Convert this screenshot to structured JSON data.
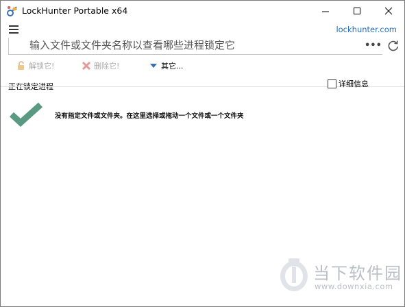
{
  "window": {
    "title": "LockHunter Portable x64",
    "icon": "lockhunter-app-icon"
  },
  "controls": {
    "minimize": "minimize-icon",
    "maximize": "maximize-icon",
    "close": "close-icon"
  },
  "header": {
    "menu_icon": "hamburger-menu-icon",
    "site_link": "lockhunter.com"
  },
  "path_input": {
    "placeholder": "输入文件或文件夹名称以查看哪些进程锁定它",
    "value": "",
    "browse_label": "•••",
    "refresh_icon": "refresh-icon"
  },
  "toolbar": {
    "unlock_label": "解锁它!",
    "delete_label": "删除它!",
    "other_label": "其它..."
  },
  "section": {
    "label": "正在锁定进程",
    "details_label": "详细信息",
    "details_checked": false
  },
  "status": {
    "message": "没有指定文件或文件夹。在这里选择或拖动一个文件或一个文件夹",
    "icon": "checkmark-icon",
    "icon_color": "#5b9a82"
  },
  "watermark": {
    "name": "当下软件园",
    "url": "www.downxia.com"
  },
  "colors": {
    "link": "#1f6fc5",
    "disabled_text": "#a9a9a9",
    "check": "#5b9a82"
  }
}
